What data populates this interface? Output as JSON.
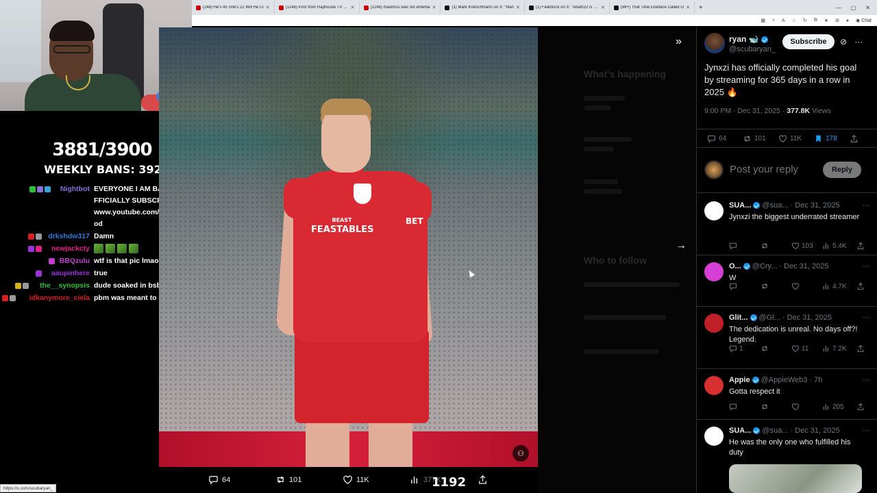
{
  "browser": {
    "tabs": [
      {
        "title": "(248) He's 45 She's 22 Will He Cl",
        "color": "#cc0000"
      },
      {
        "title": "(1248) Post from Raphouse TV - Y",
        "color": "#cc0000"
      },
      {
        "title": "(1248) maximus was not entertai",
        "color": "#cc0000"
      },
      {
        "title": "(1) Mark Kretschmann on X: \"Man",
        "color": "#111111"
      },
      {
        "title": "(1) FearBuck on X: \"Adam22 is set",
        "color": "#111111"
      },
      {
        "title": "(99+) That Time Elseface Called O",
        "color": "#111111"
      }
    ],
    "new_tab": "+",
    "chat_label": "Chat",
    "status_url": "https://x.com/scubaryan_"
  },
  "stream": {
    "counter": "3881/3900",
    "weekly_bans": "WEEKLY BANS: 392",
    "twitch_count": "1192",
    "chat": [
      {
        "user": "Nightbot",
        "color": "#8a6fd6",
        "message": "EVERYONE I AM BACK ON YOUTUBE OFFICIALLY SUBSCRIBE NOW! -> https://www.youtube.com/@TheRealLowTierGod"
      },
      {
        "user": "drkshdw317",
        "color": "#2e7bd6",
        "message": "Damn"
      },
      {
        "user": "newjackcty",
        "color": "#e0218a",
        "message": ""
      },
      {
        "user": "BBQzulu",
        "color": "#c03fcf",
        "message": "wtf is that pic lmaoo"
      },
      {
        "user": "aaupinhere",
        "color": "#9a34d6",
        "message": "true"
      },
      {
        "user": "the__synopsis",
        "color": "#2fbf3c",
        "message": "dude soaked in bsby oil"
      },
      {
        "user": "idkanymore_ciela",
        "color": "#d61f1f",
        "message": "pbm was meant to do that"
      }
    ]
  },
  "photo": {
    "sponsor_top": "BEAST",
    "sponsor_main": "FEASTABLES",
    "sleeve_text": "BET",
    "actions": {
      "replies": "64",
      "reposts": "101",
      "likes": "11K",
      "views": "377K"
    }
  },
  "post": {
    "author_name": "ryan",
    "author_emoji": "🐋",
    "author_handle": "@scubaryan_",
    "subscribe_label": "Subscribe",
    "text": "Jynxzi has officially completed his goal by streaming for 365 days in a row in 2025 🔥",
    "time": "9:00 PM · Dec 31, 2025 · ",
    "views": "377.8K",
    "views_label": " Views",
    "stats": {
      "replies": "64",
      "reposts": "101",
      "likes": "11K",
      "bookmarks": "178"
    },
    "reply_placeholder": "Post your reply",
    "reply_button": "Reply"
  },
  "replies": [
    {
      "name": "SUA...",
      "handle": "@sua...",
      "date": "Dec 31, 2025",
      "text": "Jynxzi the biggest underrated streamer",
      "replies": "",
      "reposts": "",
      "likes": "103",
      "views": "5.4K",
      "avatar": "#ffffff"
    },
    {
      "name": "O...",
      "handle": "@Cry...",
      "date": "Dec 31, 2025",
      "text": "W",
      "replies": "",
      "reposts": "",
      "likes": "",
      "views": "4.7K",
      "avatar": "#d63fd6"
    },
    {
      "name": "Glit...",
      "handle": "@Gl...",
      "date": "Dec 31, 2025",
      "text": "The dedication is unreal. No days off?! Legend.",
      "replies": "1",
      "reposts": "",
      "likes": "11",
      "views": "7.2K",
      "avatar": "#c0202a"
    },
    {
      "name": "Appie",
      "handle": "@AppieWeb3",
      "date": "7h",
      "text": "Gotta respect it",
      "replies": "",
      "reposts": "",
      "likes": "",
      "views": "205",
      "avatar": "#d63030"
    },
    {
      "name": "SUA...",
      "handle": "@sua...",
      "date": "Dec 31, 2025",
      "text": "He was the only one who fulfilled his duty",
      "replies": "",
      "reposts": "",
      "likes": "",
      "views": "",
      "avatar": "#ffffff"
    }
  ],
  "background_sidebar": {
    "whats_happening": "What's happening",
    "who_to_follow": "Who to follow"
  }
}
